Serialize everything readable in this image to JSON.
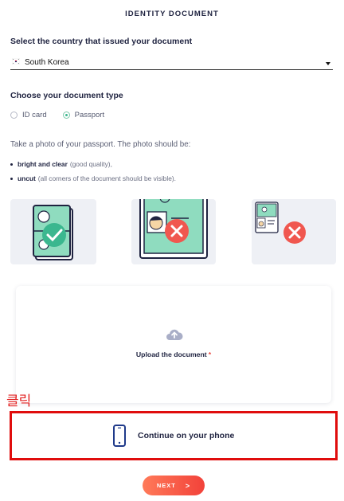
{
  "header": {
    "title": "IDENTITY DOCUMENT"
  },
  "country": {
    "label": "Select the country that issued your document",
    "selected": "South Korea",
    "flag_icon": "south-korea-flag-icon"
  },
  "doc_type": {
    "label": "Choose your document type",
    "options": [
      {
        "label": "ID card",
        "checked": false
      },
      {
        "label": "Passport",
        "checked": true
      }
    ]
  },
  "instructions": {
    "text": "Take a photo of your passport. The photo should be:",
    "bullets": [
      {
        "bold": "bright and clear",
        "rest": "(good quality),"
      },
      {
        "bold": "uncut",
        "rest": "(all corners of the document should be visible)."
      }
    ]
  },
  "examples": [
    {
      "name": "correct-example",
      "status": "correct",
      "icon": "check-icon"
    },
    {
      "name": "cropped-example",
      "status": "incorrect",
      "icon": "x-icon"
    },
    {
      "name": "small-example",
      "status": "incorrect",
      "icon": "x-icon"
    }
  ],
  "upload": {
    "label": "Upload the document",
    "required_mark": "*",
    "icon": "cloud-upload-icon"
  },
  "annotation": {
    "label": "클릭",
    "color": "#e00d0d"
  },
  "phone": {
    "label": "Continue on your phone",
    "icon": "smartphone-icon"
  },
  "next": {
    "label": "NEXT",
    "arrow": ">"
  },
  "colors": {
    "accent_green": "#3bb78f",
    "error_red": "#f0574f",
    "button_orange": "#ff7a59",
    "button_red": "#f2423a",
    "icon_blue": "#1f3a8a"
  }
}
